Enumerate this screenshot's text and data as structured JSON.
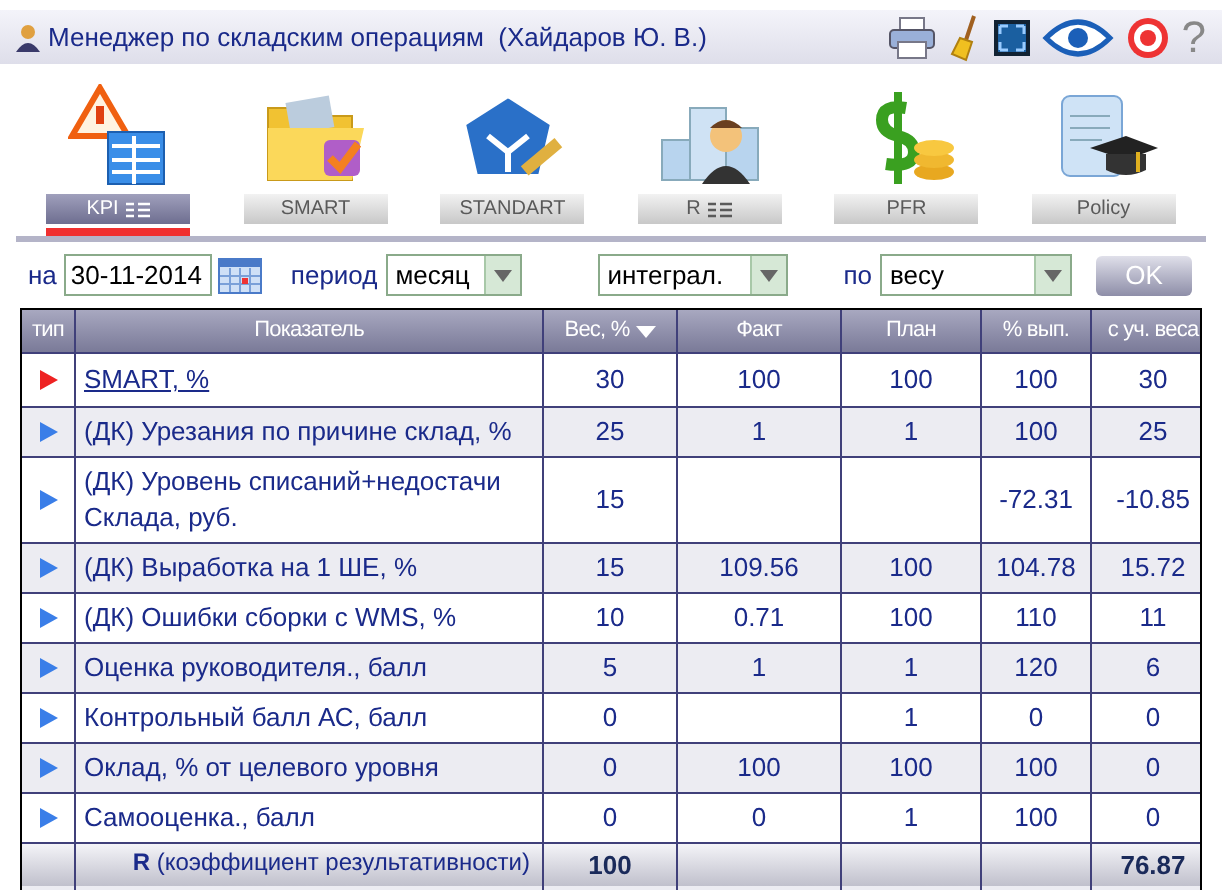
{
  "title_bar": {
    "title": "Менеджер по складским операциям  (Хайдаров Ю. В.)",
    "help_glyph": "?"
  },
  "tabs": [
    {
      "label": "KPI",
      "list_icon": true,
      "selected": true
    },
    {
      "label": "SMART",
      "list_icon": false,
      "selected": false
    },
    {
      "label": "STANDART",
      "list_icon": false,
      "selected": false
    },
    {
      "label": "R",
      "list_icon": true,
      "selected": false
    },
    {
      "label": "PFR",
      "list_icon": false,
      "selected": false
    },
    {
      "label": "Policy",
      "list_icon": false,
      "selected": false
    }
  ],
  "filters": {
    "date_label": "на",
    "date": "30-11-2014",
    "period_label": "период",
    "period": "месяц",
    "mode": "интеграл.",
    "by_label": "по",
    "by": "весу",
    "ok": "OK"
  },
  "table": {
    "columns": [
      {
        "label": "тип",
        "sorted": false
      },
      {
        "label": "Показатель",
        "sorted": false
      },
      {
        "label": "Вес, %",
        "sorted": true
      },
      {
        "label": "Факт",
        "sorted": false
      },
      {
        "label": "План",
        "sorted": false
      },
      {
        "label": "% вып.",
        "sorted": false
      },
      {
        "label": "с уч. веса",
        "sorted": false
      }
    ],
    "rows": [
      {
        "color": "#ee2222",
        "kind": "link",
        "cells": [
          "",
          "SMART, %",
          "30",
          "100",
          "100",
          "100",
          "30"
        ]
      },
      {
        "color": "#3a7ee8",
        "kind": "text",
        "cells": [
          "",
          "(ДК) Урезания по причине склад, %",
          "25",
          "1",
          "1",
          "100",
          "25"
        ]
      },
      {
        "color": "#3a7ee8",
        "kind": "text",
        "cells": [
          "",
          "(ДК) Уровень списаний+недостачи Склада, руб.",
          "15",
          "",
          "",
          "-72.31",
          "-10.85"
        ]
      },
      {
        "color": "#3a7ee8",
        "kind": "text",
        "cells": [
          "",
          "(ДК) Выработка на 1 ШЕ, %",
          "15",
          "109.56",
          "100",
          "104.78",
          "15.72"
        ]
      },
      {
        "color": "#3a7ee8",
        "kind": "text",
        "cells": [
          "",
          "(ДК) Ошибки сборки с WMS, %",
          "10",
          "0.71",
          "100",
          "110",
          "11"
        ]
      },
      {
        "color": "#3a7ee8",
        "kind": "text",
        "cells": [
          "",
          "Оценка руководителя., балл",
          "5",
          "1",
          "1",
          "120",
          "6"
        ]
      },
      {
        "color": "#3a7ee8",
        "kind": "text",
        "cells": [
          "",
          "Контрольный балл АС, балл",
          "0",
          "",
          "1",
          "0",
          "0"
        ]
      },
      {
        "color": "#3a7ee8",
        "kind": "text",
        "cells": [
          "",
          "Оклад, % от целевого уровня",
          "0",
          "100",
          "100",
          "100",
          "0"
        ]
      },
      {
        "color": "#3a7ee8",
        "kind": "text",
        "cells": [
          "",
          "Самооценка., балл",
          "0",
          "0",
          "1",
          "100",
          "0"
        ]
      }
    ],
    "total": {
      "cells": [
        "",
        "**R** (коэффициент результативности)",
        "100",
        "",
        "",
        "",
        "76.87"
      ]
    }
  }
}
